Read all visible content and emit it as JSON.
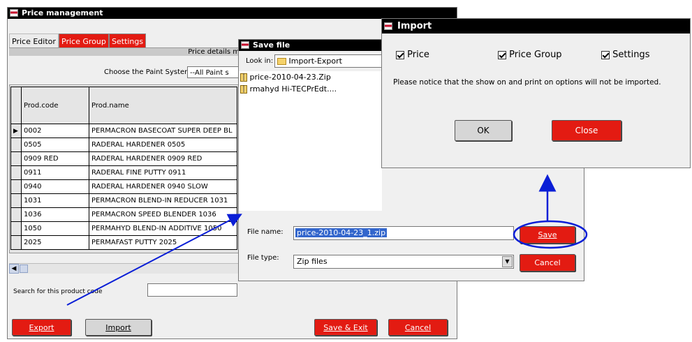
{
  "main_window": {
    "title": "Price management",
    "tabs": [
      "Price Editor",
      "Price Group",
      "Settings"
    ],
    "header_label": "Price details m",
    "paint_system_label": "Choose the Paint System",
    "paint_system_value": "--All Paint s",
    "columns": [
      "Prod.code",
      "Prod.name"
    ],
    "rows": [
      {
        "code": "0002",
        "name": "PERMACRON BASECOAT SUPER DEEP BL"
      },
      {
        "code": "0505",
        "name": "RADERAL HARDENER 0505"
      },
      {
        "code": "0909 RED",
        "name": "RADERAL HARDENER 0909 RED"
      },
      {
        "code": "0911",
        "name": "RADERAL FINE PUTTY 0911"
      },
      {
        "code": "0940",
        "name": "RADERAL HARDENER 0940 SLOW"
      },
      {
        "code": "1031",
        "name": "PERMACRON BLEND-IN REDUCER 1031"
      },
      {
        "code": "1036",
        "name": "PERMACRON SPEED BLENDER 1036"
      },
      {
        "code": "1050",
        "name": "PERMAHYD BLEND-IN ADDITIVE 1050"
      },
      {
        "code": "2025",
        "name": "PERMAFAST PUTTY 2025"
      }
    ],
    "search_label": "Search for this product code",
    "search_value": "",
    "buttons": {
      "export": "Export",
      "import": "Import",
      "save_exit": "Save & Exit",
      "cancel": "Cancel"
    }
  },
  "save_dialog": {
    "title": "Save file",
    "look_in_label": "Look in:",
    "look_in_value": "Import-Export",
    "files": [
      "price-2010-04-23.Zip",
      "rmahyd Hi-TECPrEdt...."
    ],
    "file_name_label": "File name:",
    "file_name_value": "price-2010-04-23_1.zip",
    "file_type_label": "File type:",
    "file_type_value": "Zip files",
    "save_label": "Save",
    "cancel_label": "Cancel"
  },
  "import_dialog": {
    "title": "Import",
    "options": [
      "Price",
      "Price Group",
      "Settings"
    ],
    "notice": "Please notice that the show on and print on options will not be imported.",
    "ok_label": "OK",
    "close_label": "Close"
  },
  "colors": {
    "accent_red": "#e31b12",
    "annotation_blue": "#0a1ed6"
  }
}
